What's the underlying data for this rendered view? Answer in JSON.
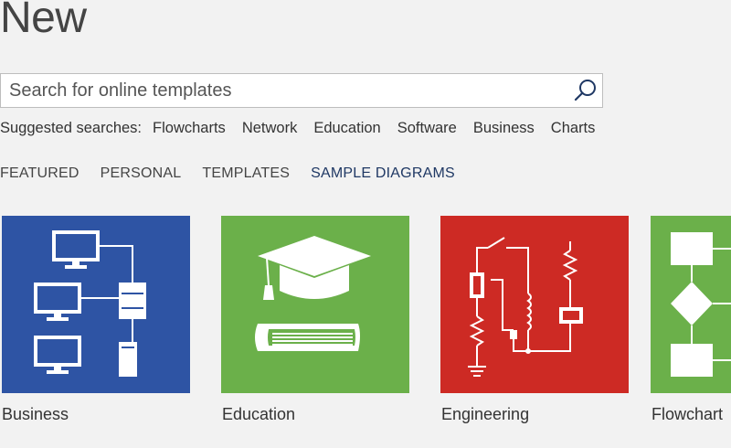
{
  "header": {
    "title": "New"
  },
  "search": {
    "placeholder": "Search for online templates",
    "value": ""
  },
  "suggested": {
    "label": "Suggested searches:",
    "items": [
      "Flowcharts",
      "Network",
      "Education",
      "Software",
      "Business",
      "Charts"
    ]
  },
  "tabs": [
    {
      "label": "FEATURED",
      "active": false
    },
    {
      "label": "PERSONAL",
      "active": false
    },
    {
      "label": "TEMPLATES",
      "active": false
    },
    {
      "label": "SAMPLE DIAGRAMS",
      "active": true
    }
  ],
  "templates": [
    {
      "label": "Business",
      "color": "#2e54a4",
      "icon": "network-computers-icon"
    },
    {
      "label": "Education",
      "color": "#6bb04a",
      "icon": "graduation-cap-book-icon"
    },
    {
      "label": "Engineering",
      "color": "#cd2a24",
      "icon": "circuit-diagram-icon"
    },
    {
      "label": "Flowchart",
      "color": "#6bb04a",
      "icon": "flowchart-shapes-icon"
    }
  ],
  "colors": {
    "active_tab": "#1f3864",
    "background": "#f2f2f2"
  }
}
